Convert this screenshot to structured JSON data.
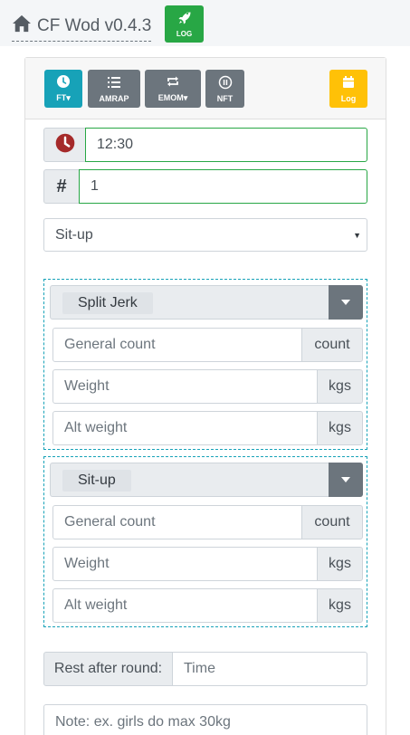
{
  "header": {
    "title": "CF Wod v0.4.3",
    "home_icon": "home-icon",
    "log_button": {
      "label": "LOG",
      "icon": "rocket-icon",
      "color": "#28a745"
    }
  },
  "modes": [
    {
      "label": "FT▾",
      "icon": "clock-icon",
      "color": "#17a2b8"
    },
    {
      "label": "AMRAP",
      "icon": "list-icon",
      "color": "#6c757d"
    },
    {
      "label": "EMOM▾",
      "icon": "repeat-icon",
      "color": "#6c757d"
    },
    {
      "label": "NFT",
      "icon": "pause-icon",
      "color": "#6c757d"
    }
  ],
  "log_button": {
    "label": "Log",
    "icon": "calendar-icon",
    "color": "#ffc107"
  },
  "time_field": {
    "icon": "clock-icon",
    "value": "12:30"
  },
  "rounds_field": {
    "icon_text": "#",
    "value": "1"
  },
  "exercise_select": {
    "value": "Sit-up"
  },
  "movement_groups": [
    {
      "move": "Split Jerk",
      "count_placeholder": "General count",
      "count_unit": "count",
      "weight_placeholder": "Weight",
      "weight_unit": "kgs",
      "alt_weight_placeholder": "Alt weight",
      "alt_weight_unit": "kgs"
    },
    {
      "move": "Sit-up",
      "count_placeholder": "General count",
      "count_unit": "count",
      "weight_placeholder": "Weight",
      "weight_unit": "kgs",
      "alt_weight_placeholder": "Alt weight",
      "alt_weight_unit": "kgs"
    }
  ],
  "rest": {
    "label": "Rest after round:",
    "placeholder": "Time"
  },
  "note": {
    "placeholder": "Note: ex. girls do max 30kg"
  }
}
